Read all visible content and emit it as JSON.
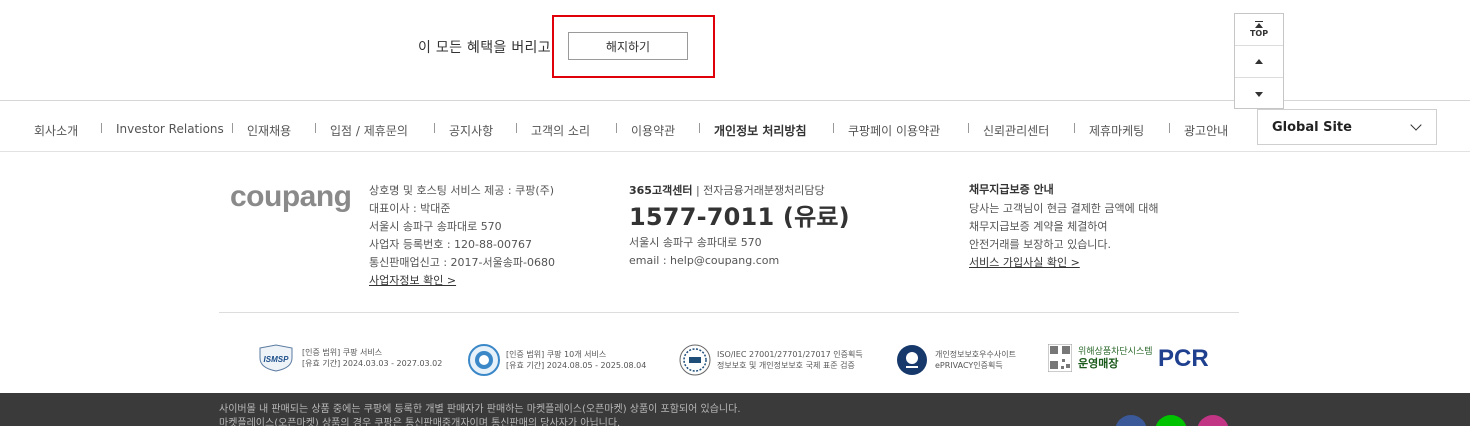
{
  "membership": {
    "cancel_prompt": "이 모든 혜택을 버리고",
    "cancel_button": "해지하기"
  },
  "scroll_widget": {
    "top_label": "TOP"
  },
  "nav": {
    "items": [
      "회사소개",
      "Investor Relations",
      "인재채용",
      "입점 / 제휴문의",
      "공지사항",
      "고객의 소리",
      "이용약관",
      "개인정보 처리방침",
      "쿠팡페이 이용약관",
      "신뢰관리센터",
      "제휴마케팅",
      "광고안내"
    ],
    "global_site": "Global Site"
  },
  "company": {
    "logo": "coupang",
    "lines": [
      "상호명 및 호스팅 서비스 제공 : 쿠팡(주)",
      "대표이사 : 박대준",
      "서울시 송파구 송파대로 570",
      "사업자 등록번호 : 120-88-00767",
      "통신판매업신고 : 2017-서울송파-0680"
    ],
    "business_info_link": "사업자정보 확인 >"
  },
  "customer_center": {
    "title_bold": "365고객센터",
    "title_rest": " | 전자금융거래분쟁처리담당",
    "phone": "1577-7011 (유료)",
    "address": "서울시 송파구 송파대로 570",
    "email": "email : help@coupang.com"
  },
  "guarantee": {
    "title": "채무지급보증 안내",
    "lines": [
      "당사는 고객님이 현금 결제한 금액에 대해",
      "채무지급보증 계약을 체결하여",
      "안전거래를 보장하고 있습니다."
    ],
    "link": "서비스 가입사실 확인 >"
  },
  "certs": [
    {
      "logo": "ISMSP",
      "lines": [
        "[인증 범위] 쿠팡 서비스",
        "[유효 기간] 2024.03.03 - 2027.03.02"
      ]
    },
    {
      "lines": [
        "[인증 범위] 쿠팡 10개 서비스",
        "[유효 기간] 2024.08.05 - 2025.08.04"
      ]
    },
    {
      "lines": [
        "ISO/IEC 27001/27701/27017 인증획득",
        "정보보호 및 개인정보보호 국제 표준 검증"
      ]
    },
    {
      "lines": [
        "개인정보보호우수사이트",
        "ePRIVACY인증획득"
      ]
    },
    {
      "lines": [
        "위해상품차단시스템",
        "운영매장"
      ]
    },
    {
      "logo": "PCR"
    }
  ],
  "footer_dark": {
    "line1": "사이버몰 내 판매되는 상품 중에는 쿠팡에 등록한 개별 판매자가 판매하는 마켓플레이스(오픈마켓) 상품이 포함되어 있습니다.",
    "line2": "마켓플레이스(오픈마켓) 상품의 경우 쿠팡은 통신판매중개자이며 통신판매의 당사자가 아닙니다."
  },
  "colors": {
    "highlight": "#e0000a",
    "logo_gray": "#8a8a8a",
    "footer_bg": "#3a3a3a",
    "facebook": "#3b5998",
    "line": "#00c300",
    "instagram": "#c13584"
  }
}
